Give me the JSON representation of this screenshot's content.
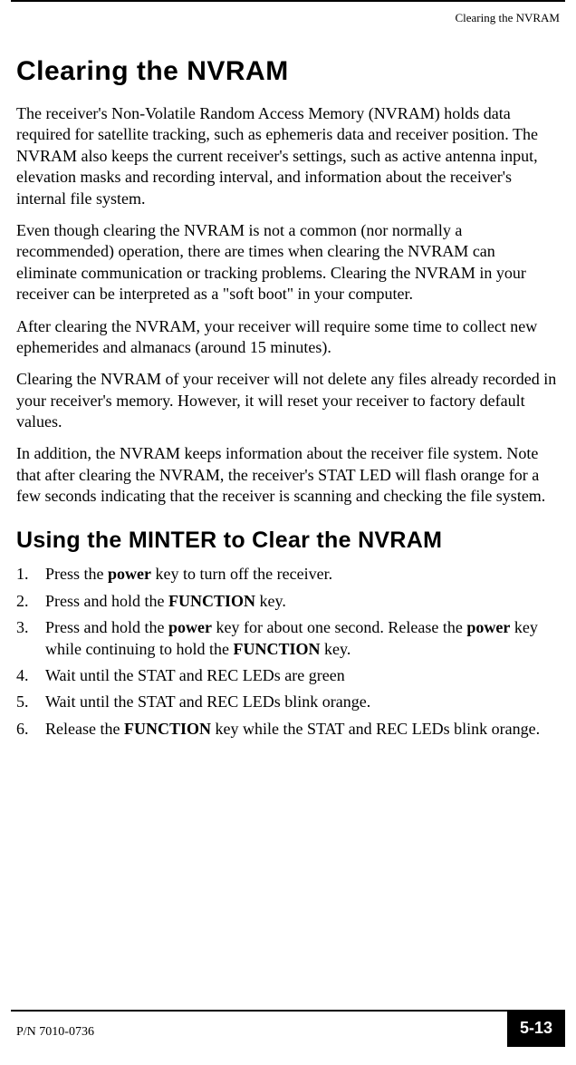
{
  "header": {
    "title": "Clearing the NVRAM"
  },
  "main": {
    "h1": "Clearing the NVRAM",
    "p1": "The receiver's Non-Volatile Random Access Memory (NVRAM) holds data required for satellite tracking, such as ephemeris data and receiver position. The NVRAM also keeps the current receiver's settings, such as active antenna input, elevation masks and recording interval, and information about the receiver's internal file system.",
    "p2": "Even though clearing the NVRAM is not a common (nor normally a recommended) operation, there are times when clearing the NVRAM can eliminate communication or tracking problems. Clearing the NVRAM in your receiver can be interpreted as a \"soft boot\" in your computer.",
    "p3": "After clearing the NVRAM, your receiver will require some time to collect new ephemerides and almanacs (around 15 minutes).",
    "p4": "Clearing the NVRAM of your receiver will not delete any files already recorded in your receiver's memory. However, it will reset your receiver to factory default values.",
    "p5": "In addition, the NVRAM keeps information about the receiver file system. Note that after clearing the NVRAM, the receiver's STAT LED will flash orange for a few seconds indicating that the receiver is scanning and checking the file system.",
    "h2": "Using the MINTER to Clear the NVRAM",
    "steps": {
      "s1_a": "Press the ",
      "s1_b": "power",
      "s1_c": " key to turn off the receiver.",
      "s2_a": "Press and hold the ",
      "s2_b": "FUNCTION",
      "s2_c": " key.",
      "s3_a": "Press and hold the ",
      "s3_b": "power",
      "s3_c": " key for about one second. Release the ",
      "s3_d": "power",
      "s3_e": " key while continuing to hold the ",
      "s3_f": "FUNCTION",
      "s3_g": " key.",
      "s4": "Wait until the STAT and REC LEDs are green",
      "s5": "Wait until the STAT and REC LEDs blink orange.",
      "s6_a": "Release the ",
      "s6_b": "FUNCTION",
      "s6_c": " key while the STAT and REC LEDs blink orange."
    }
  },
  "footer": {
    "pn": "P/N 7010-0736",
    "page": "5-13"
  }
}
